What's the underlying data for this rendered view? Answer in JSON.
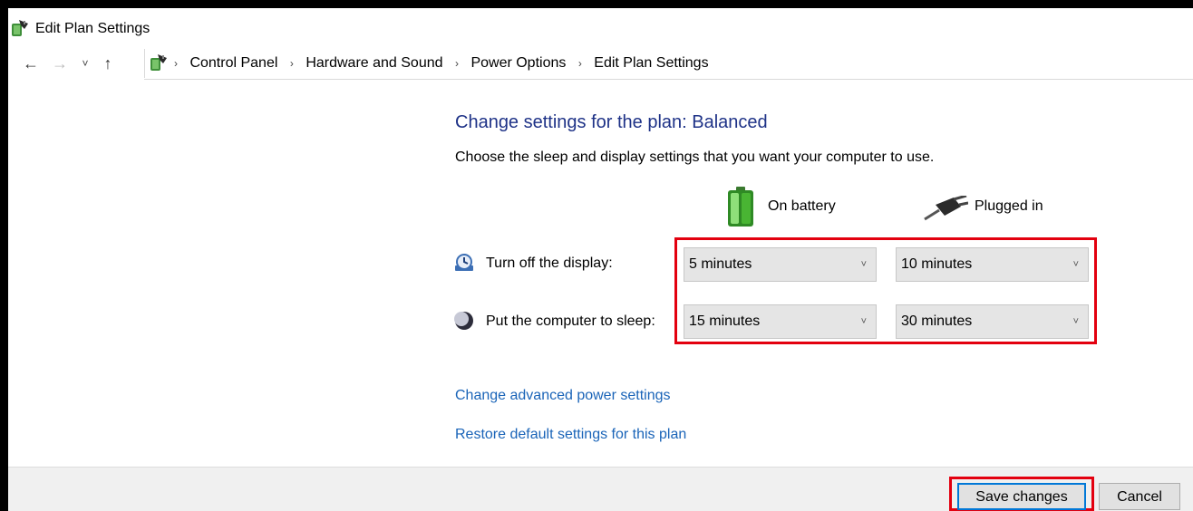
{
  "window": {
    "title": "Edit Plan Settings",
    "title_icon": "power-options-icon"
  },
  "nav": {
    "back_icon": "back-arrow-icon",
    "back_glyph": "←",
    "forward_icon": "forward-arrow-icon",
    "forward_glyph": "→",
    "recent_icon": "recent-locations-chevron-icon",
    "recent_glyph": "˅",
    "up_icon": "up-arrow-icon",
    "up_glyph": "↑",
    "separator_glyph": "›",
    "breadcrumb": [
      "Control Panel",
      "Hardware and Sound",
      "Power Options",
      "Edit Plan Settings"
    ]
  },
  "main": {
    "heading": "Change settings for the plan: Balanced",
    "subheading": "Choose the sleep and display settings that you want your computer to use.",
    "columns": {
      "battery_label": "On battery",
      "battery_icon": "battery-icon",
      "plugged_label": "Plugged in",
      "plugged_icon": "power-plug-icon"
    },
    "rows": [
      {
        "label": "Turn off the display:",
        "icon": "display-clock-icon",
        "on_battery": "5 minutes",
        "plugged_in": "10 minutes"
      },
      {
        "label": "Put the computer to sleep:",
        "icon": "moon-sleep-icon",
        "on_battery": "15 minutes",
        "plugged_in": "30 minutes"
      }
    ],
    "dropdown_chevron": "˅",
    "links": {
      "advanced": "Change advanced power settings",
      "restore": "Restore default settings for this plan"
    }
  },
  "footer": {
    "save_label": "Save changes",
    "cancel_label": "Cancel"
  },
  "colors": {
    "heading": "#1e3287",
    "link": "#1a64b8",
    "highlight": "#e3000f",
    "focus_border": "#0078d7"
  }
}
